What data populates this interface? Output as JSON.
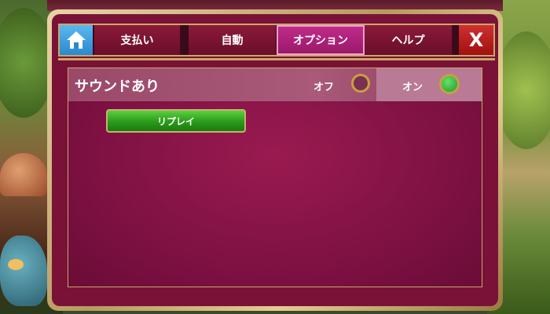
{
  "tabs": [
    {
      "label": "支払い",
      "active": false
    },
    {
      "label": "自動",
      "active": false
    },
    {
      "label": "オプション",
      "active": true
    },
    {
      "label": "ヘルプ",
      "active": false
    }
  ],
  "close_label": "X",
  "sound": {
    "label": "サウンドあり",
    "off_label": "オフ",
    "on_label": "オン",
    "selected": "on"
  },
  "replay_label": "リプレイ",
  "colors": {
    "panel": "#7a1238",
    "tab_active": "#c02a8a",
    "home": "#2a88d0",
    "close": "#c02020",
    "radio_on": "#2ab03a",
    "button_green": "#2a9a1a",
    "gold": "#c8a866"
  },
  "icons": [
    "home-icon",
    "close-icon"
  ]
}
